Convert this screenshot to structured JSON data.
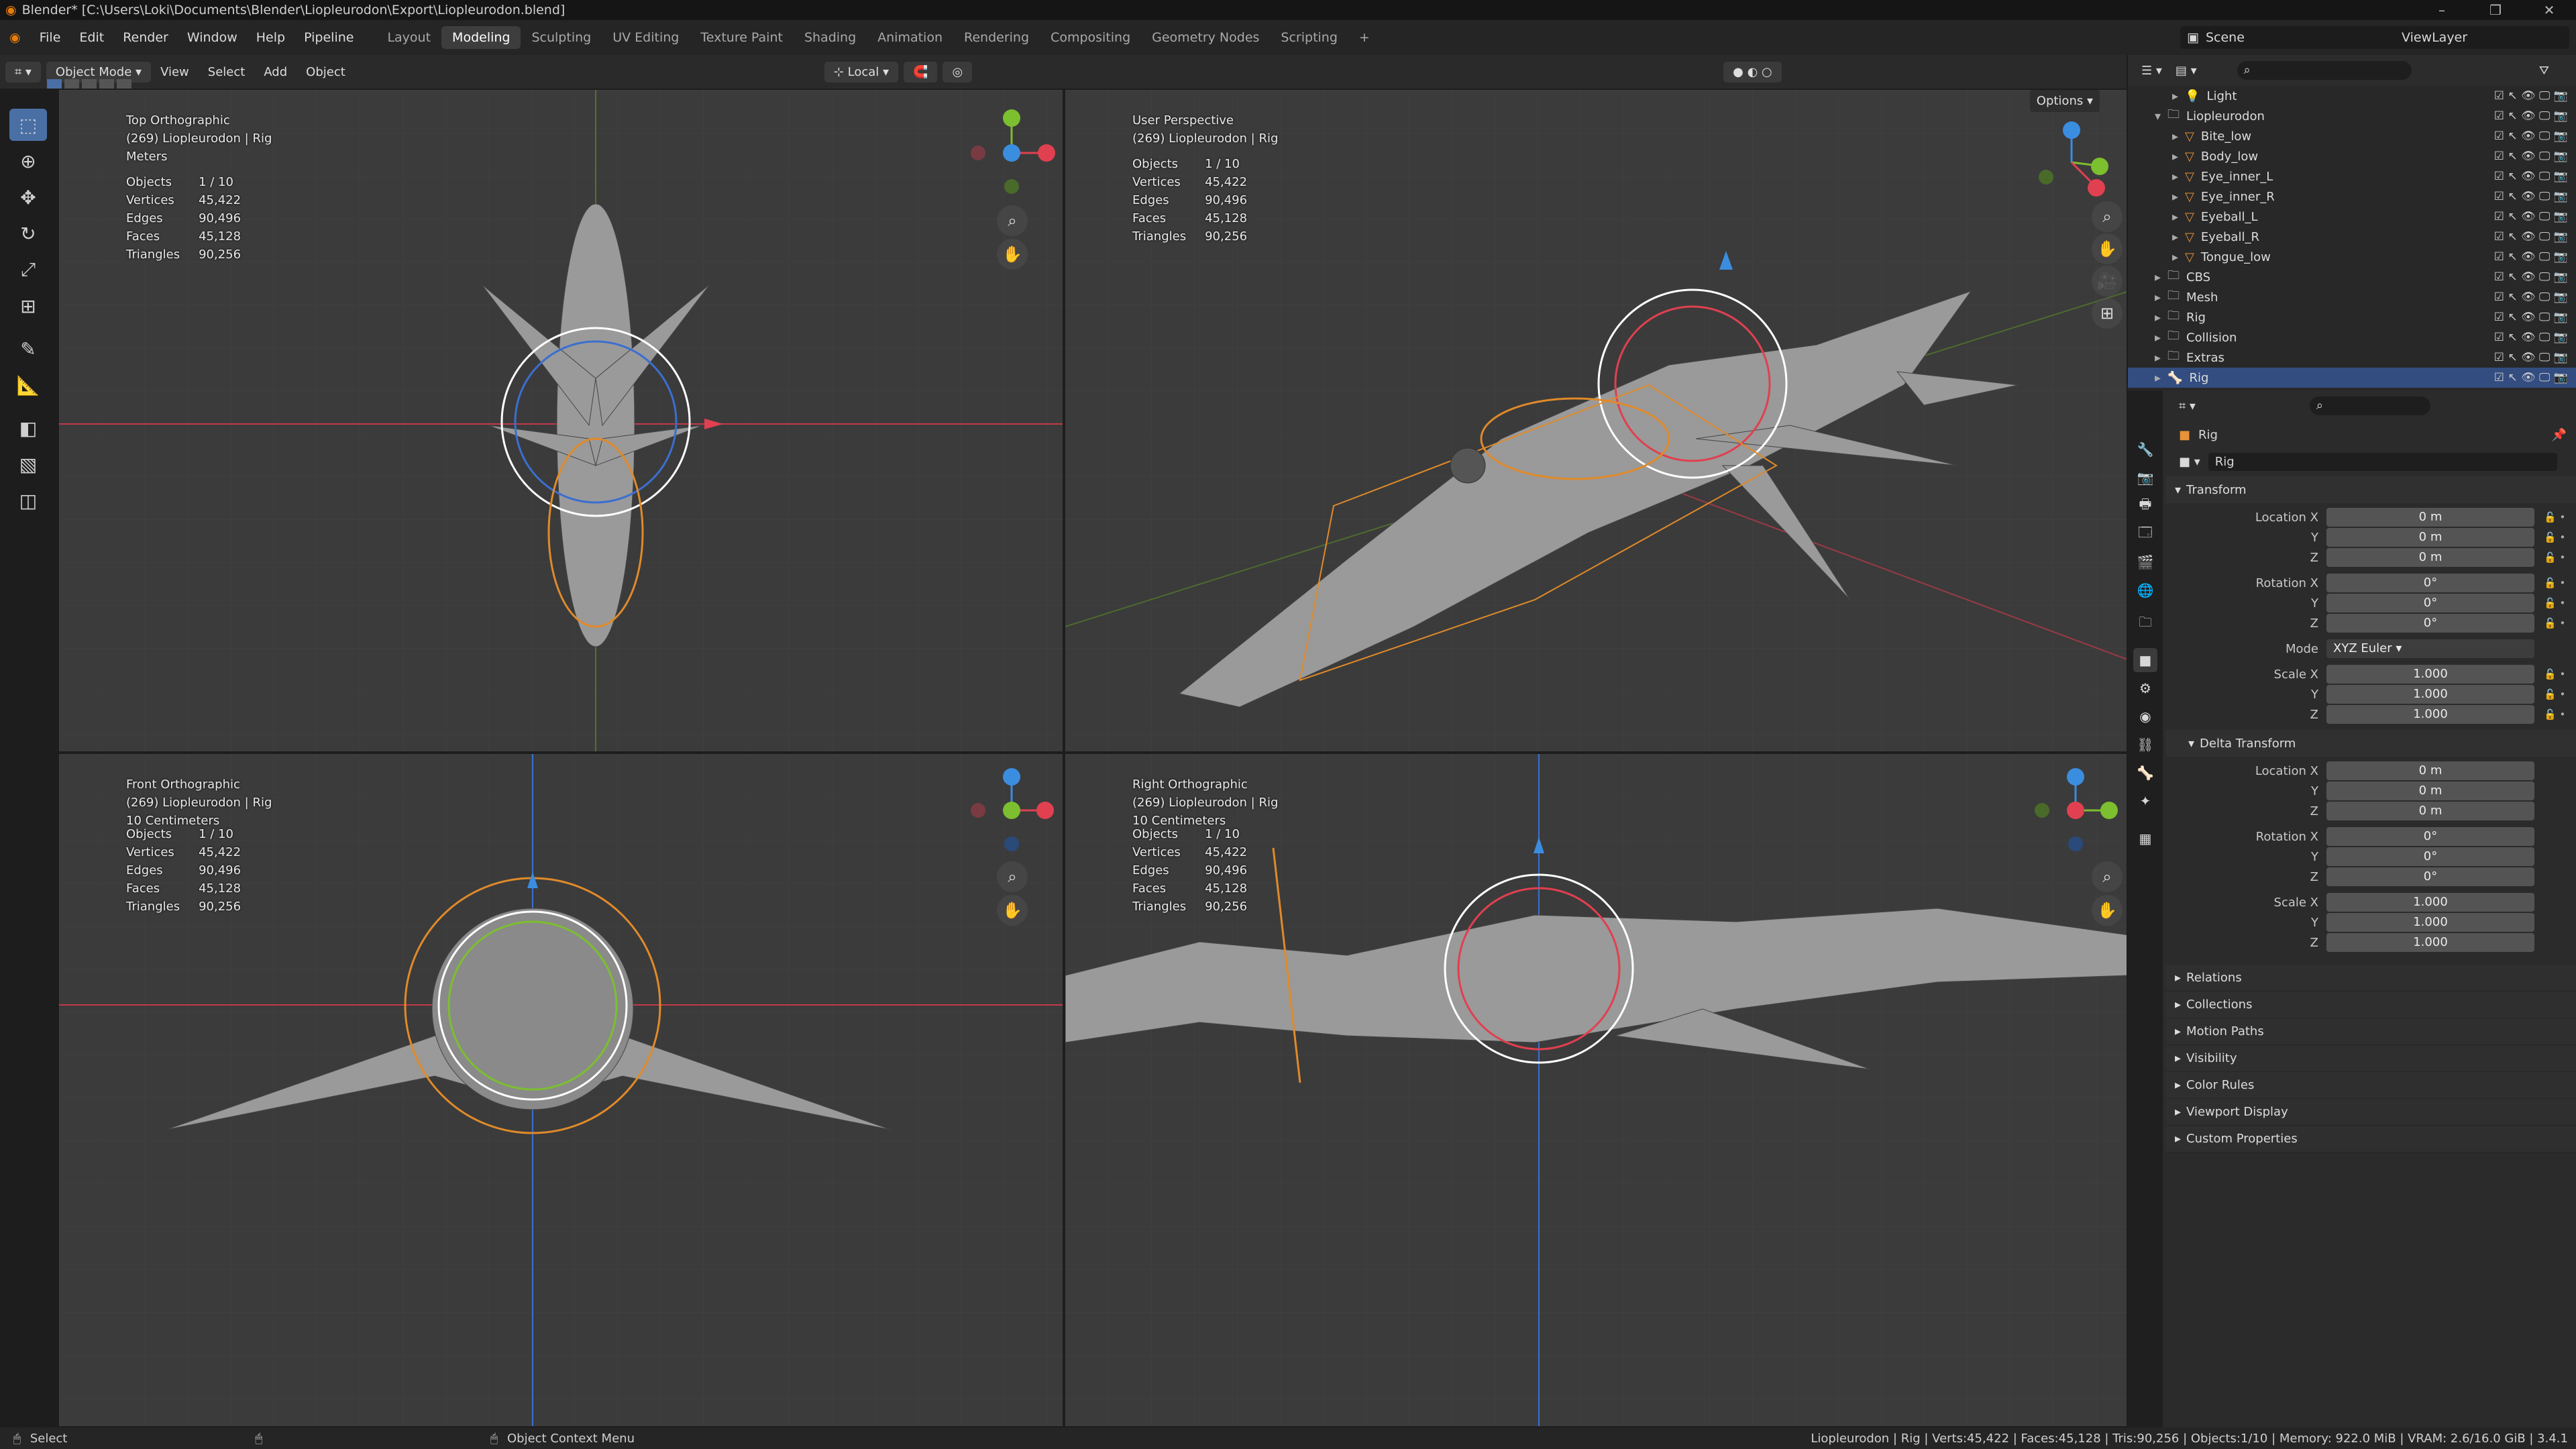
{
  "window": {
    "title": "Blender* [C:\\Users\\Loki\\Documents\\Blender\\Liopleurodon\\Export\\Liopleurodon.blend]",
    "controls": [
      "–",
      "❐",
      "✕"
    ]
  },
  "menu": [
    "File",
    "Edit",
    "Render",
    "Window",
    "Help",
    "Pipeline"
  ],
  "workspaces": [
    "Layout",
    "Modeling",
    "Sculpting",
    "UV Editing",
    "Texture Paint",
    "Shading",
    "Animation",
    "Rendering",
    "Compositing",
    "Geometry Nodes",
    "Scripting",
    "+"
  ],
  "active_workspace": "Modeling",
  "scene": {
    "name": "Scene",
    "view_layer": "ViewLayer"
  },
  "viewport_header": {
    "mode": "Object Mode",
    "menus": [
      "View",
      "Select",
      "Add",
      "Object"
    ],
    "transform_orientation": "Local",
    "options": "Options"
  },
  "viewports": [
    {
      "view": "Top Orthographic",
      "object": "(269) Liopleurodon | Rig",
      "scale": "Meters"
    },
    {
      "view": "User Perspective",
      "object": "(269) Liopleurodon | Rig",
      "scale": ""
    },
    {
      "view": "Front Orthographic",
      "object": "(269) Liopleurodon | Rig",
      "scale": "10 Centimeters"
    },
    {
      "view": "Right Orthographic",
      "object": "(269) Liopleurodon | Rig",
      "scale": "10 Centimeters"
    }
  ],
  "stats": {
    "labels": [
      "Objects",
      "Vertices",
      "Edges",
      "Faces",
      "Triangles"
    ],
    "values": [
      "1 / 10",
      "45,422",
      "90,496",
      "45,128",
      "90,256"
    ]
  },
  "outliner": {
    "rows": [
      {
        "name": "Light",
        "indent": 1,
        "icon": "light"
      },
      {
        "name": "Liopleurodon",
        "indent": 0,
        "icon": "collection"
      },
      {
        "name": "Bite_low",
        "indent": 1,
        "icon": "mesh"
      },
      {
        "name": "Body_low",
        "indent": 1,
        "icon": "mesh"
      },
      {
        "name": "Eye_inner_L",
        "indent": 1,
        "icon": "mesh"
      },
      {
        "name": "Eye_inner_R",
        "indent": 1,
        "icon": "mesh"
      },
      {
        "name": "Eyeball_L",
        "indent": 1,
        "icon": "mesh"
      },
      {
        "name": "Eyeball_R",
        "indent": 1,
        "icon": "mesh"
      },
      {
        "name": "Tongue_low",
        "indent": 1,
        "icon": "mesh"
      },
      {
        "name": "CBS",
        "indent": 0,
        "icon": "collection"
      },
      {
        "name": "Mesh",
        "indent": 0,
        "icon": "collection"
      },
      {
        "name": "Rig",
        "indent": 0,
        "icon": "collection"
      },
      {
        "name": "Collision",
        "indent": 0,
        "icon": "collection"
      },
      {
        "name": "Extras",
        "indent": 0,
        "icon": "collection"
      },
      {
        "name": "Rig",
        "indent": 0,
        "icon": "armature",
        "selected": true
      }
    ]
  },
  "properties": {
    "object_name": "Rig",
    "data_name": "Rig",
    "transform": {
      "title": "Transform",
      "location_label": "Location X",
      "location": [
        "0 m",
        "0 m",
        "0 m"
      ],
      "rotation_label": "Rotation X",
      "rotation": [
        "0°",
        "0°",
        "0°"
      ],
      "mode_label": "Mode",
      "mode": "XYZ Euler",
      "scale_label": "Scale X",
      "scale": [
        "1.000",
        "1.000",
        "1.000"
      ],
      "axis_y": "Y",
      "axis_z": "Z"
    },
    "delta": {
      "title": "Delta Transform",
      "location": [
        "0 m",
        "0 m",
        "0 m"
      ],
      "rotation": [
        "0°",
        "0°",
        "0°"
      ],
      "scale": [
        "1.000",
        "1.000",
        "1.000"
      ]
    },
    "panels": [
      "Relations",
      "Collections",
      "Motion Paths",
      "Visibility",
      "Color Rules",
      "Viewport Display",
      "Custom Properties"
    ]
  },
  "statusbar": {
    "left": "Select",
    "middle": "Object Context Menu",
    "right": "Liopleurodon | Rig | Verts:45,422 | Faces:45,128 | Tris:90,256 | Objects:1/10 | Memory: 922.0 MiB | VRAM: 2.6/16.0 GiB | 3.4.1"
  },
  "colors": {
    "accent": "#4a6fa5",
    "x_axis": "#e04050",
    "y_axis": "#7cbf2f",
    "z_axis": "#3b8de0",
    "rig": "#e08a2a"
  }
}
